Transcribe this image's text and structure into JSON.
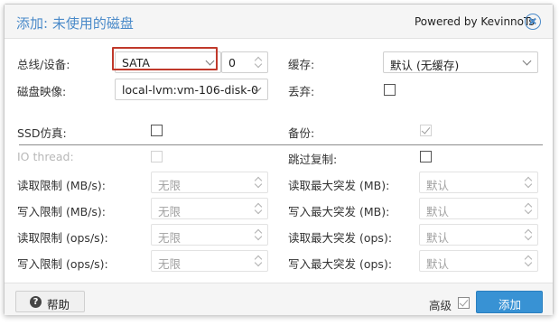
{
  "dialog": {
    "title": "添加: 未使用的磁盘",
    "powered_by": "Powered by KevinnoTs"
  },
  "form": {
    "bus_device": {
      "label": "总线/设备:",
      "bus_value": "SATA",
      "device_index": "0"
    },
    "cache": {
      "label": "缓存:",
      "value": "默认 (无缓存)"
    },
    "disk_image": {
      "label": "磁盘映像:",
      "value": "local-lvm:vm-106-disk-0"
    },
    "discard": {
      "label": "丢弃:",
      "checked": false
    },
    "ssd_emulation": {
      "label": "SSD仿真:",
      "checked": false
    },
    "backup": {
      "label": "备份:",
      "checked": true
    },
    "io_thread": {
      "label": "IO thread:",
      "checked": false,
      "disabled": true
    },
    "skip_replication": {
      "label": "跳过复制:",
      "checked": false
    },
    "read_limit_mbs": {
      "label": "读取限制 (MB/s):",
      "placeholder": "无限"
    },
    "write_limit_mbs": {
      "label": "写入限制 (MB/s):",
      "placeholder": "无限"
    },
    "read_limit_ops": {
      "label": "读取限制 (ops/s):",
      "placeholder": "无限"
    },
    "write_limit_ops": {
      "label": "写入限制 (ops/s):",
      "placeholder": "无限"
    },
    "read_burst_mb": {
      "label": "读取最大突发 (MB):",
      "placeholder": "默认"
    },
    "write_burst_mb": {
      "label": "写入最大突发 (MB):",
      "placeholder": "默认"
    },
    "read_burst_ops": {
      "label": "读取最大突发 (ops):",
      "placeholder": "默认"
    },
    "write_burst_ops": {
      "label": "写入最大突发 (ops):",
      "placeholder": "默认"
    }
  },
  "footer": {
    "help_label": "帮助",
    "help_icon": "?",
    "advanced_label": "高级",
    "advanced_checked": true,
    "add_label": "添加"
  },
  "colors": {
    "accent": "#3892d4",
    "title": "#4a8ac9",
    "highlight_border": "#c0392b"
  }
}
